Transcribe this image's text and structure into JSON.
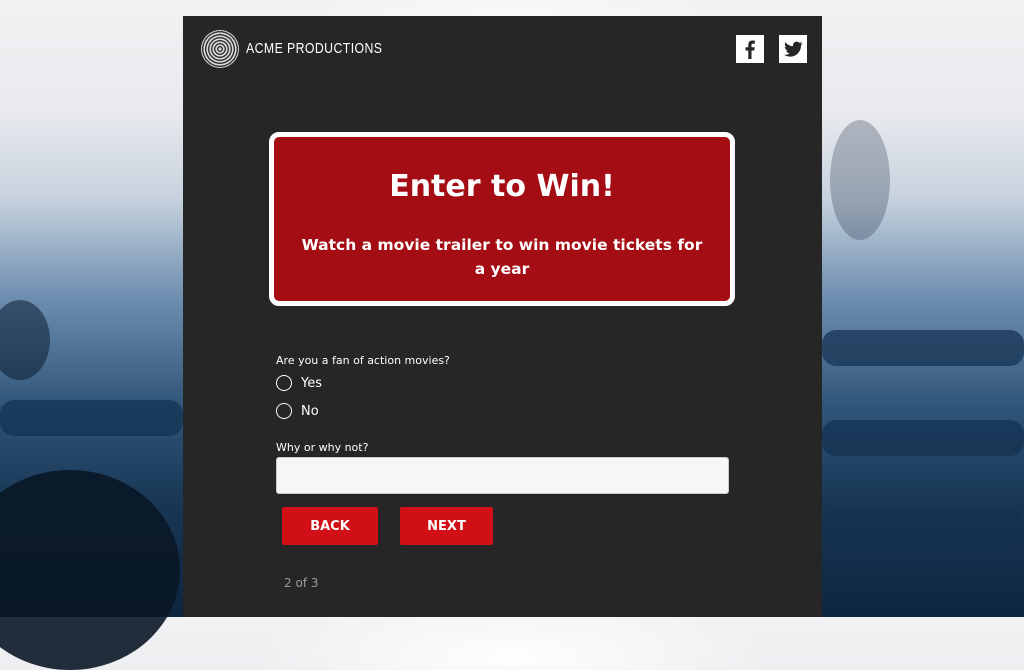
{
  "brand": {
    "name": "ACME PRODUCTIONS",
    "logo_icon": "fingerprint-logo"
  },
  "social": {
    "facebook_icon": "facebook-icon",
    "twitter_icon": "twitter-icon"
  },
  "hero": {
    "title": "Enter to Win!",
    "subtitle": "Watch a movie trailer to win movie tickets for a year"
  },
  "form": {
    "question1": "Are you a fan of action movies?",
    "options": [
      "Yes",
      "No"
    ],
    "question2": "Why or why not?",
    "answer_value": ""
  },
  "buttons": {
    "back": "BACK",
    "next": "NEXT"
  },
  "pager": "2 of 3",
  "colors": {
    "panel": "#262626",
    "accent": "#d10f17",
    "hero": "#a30d13"
  }
}
